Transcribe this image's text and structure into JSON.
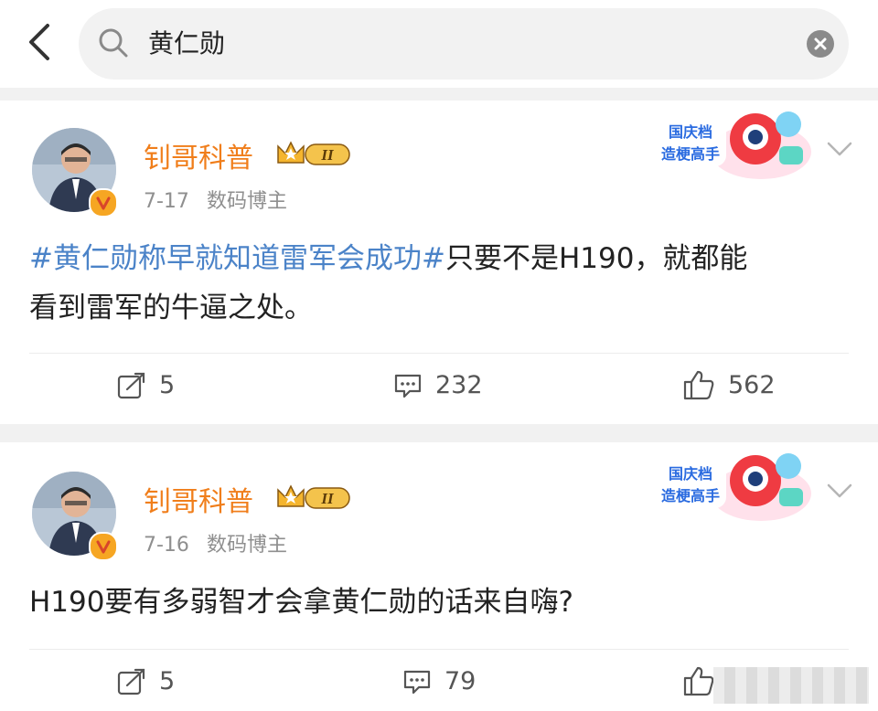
{
  "search": {
    "query": "黄仁勋"
  },
  "posts": [
    {
      "author": "钊哥科普",
      "date": "7-17",
      "role": "数码博主",
      "hashtag": "#黄仁勋称早就知道雷军会成功#",
      "text_line1": "只要不是H190，就都能",
      "text_line2": "看到雷军的牛逼之处。",
      "repost": "5",
      "comment": "232",
      "like": "562",
      "level_badge": "II",
      "sticker_text": [
        "国庆档",
        "造梗高手"
      ]
    },
    {
      "author": "钊哥科普",
      "date": "7-16",
      "role": "数码博主",
      "text": "H190要有多弱智才会拿黄仁勋的话来自嗨?",
      "repost": "5",
      "comment": "79",
      "level_badge": "II",
      "sticker_text": [
        "国庆档",
        "造梗高手"
      ]
    }
  ],
  "colors": {
    "name": "#f07e1b",
    "hashtag": "#4b83c8",
    "meta": "#8f8f8f"
  },
  "icons": [
    "back-icon",
    "search-icon",
    "clear-icon",
    "crown-icon",
    "chevron-down-icon",
    "repost-icon",
    "comment-icon",
    "like-icon",
    "verified-icon"
  ]
}
